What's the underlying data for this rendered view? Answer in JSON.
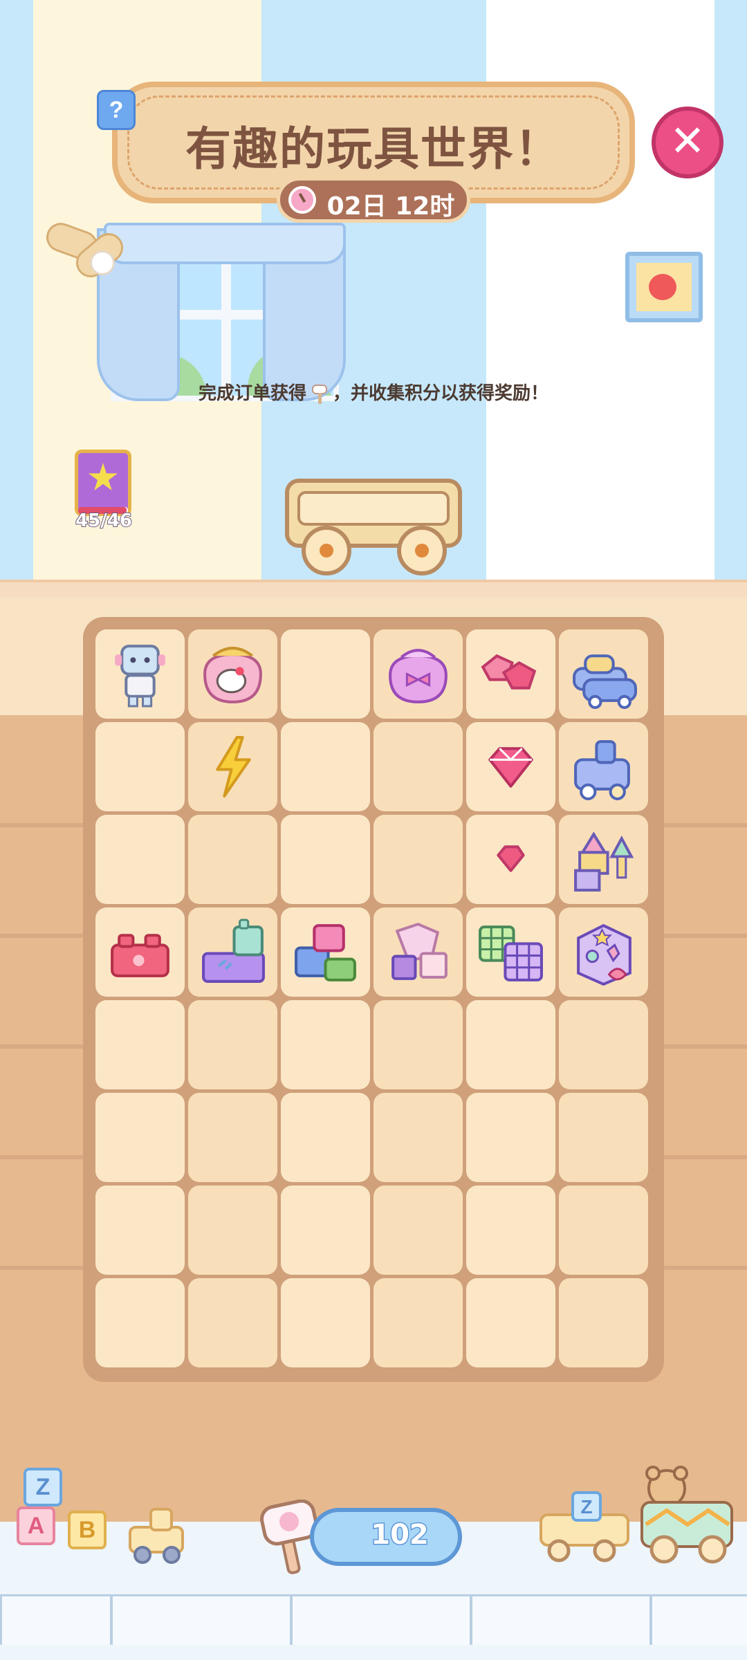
{
  "header": {
    "help_label": "?",
    "title": "有趣的玩具世界！",
    "timer": "02日 12时",
    "close_label": "✕"
  },
  "instruction": {
    "before": "完成订单获得",
    "after": "，并收集积分以获得奖励！"
  },
  "collection_book": {
    "count": "45/46",
    "progress": 0.978
  },
  "board": {
    "columns": 6,
    "rows": 8,
    "cells": [
      "robot",
      "purse-hello-kitty",
      "empty",
      "purse-bow",
      "gems-pair",
      "cars-stack",
      "empty",
      "lightning",
      "empty",
      "empty",
      "gem",
      "toy-train",
      "empty",
      "empty",
      "empty",
      "empty",
      "gem-small",
      "castle-blocks",
      "lego-single",
      "lego-tower",
      "lego-pile",
      "pastel-cubes",
      "rubik-cubes",
      "shape-sorter",
      "empty",
      "empty",
      "empty",
      "empty",
      "empty",
      "empty",
      "empty",
      "empty",
      "empty",
      "empty",
      "empty",
      "empty",
      "empty",
      "empty",
      "empty",
      "empty",
      "empty",
      "empty",
      "empty",
      "empty",
      "empty",
      "empty",
      "empty",
      "empty"
    ]
  },
  "bottom": {
    "hammer_count": "102",
    "blocks": [
      "Z",
      "A",
      "B"
    ],
    "truck_block": "Z"
  },
  "colors": {
    "accent_pink": "#ec4e86",
    "banner": "#f3d5ab",
    "board": "#cfa07a"
  }
}
